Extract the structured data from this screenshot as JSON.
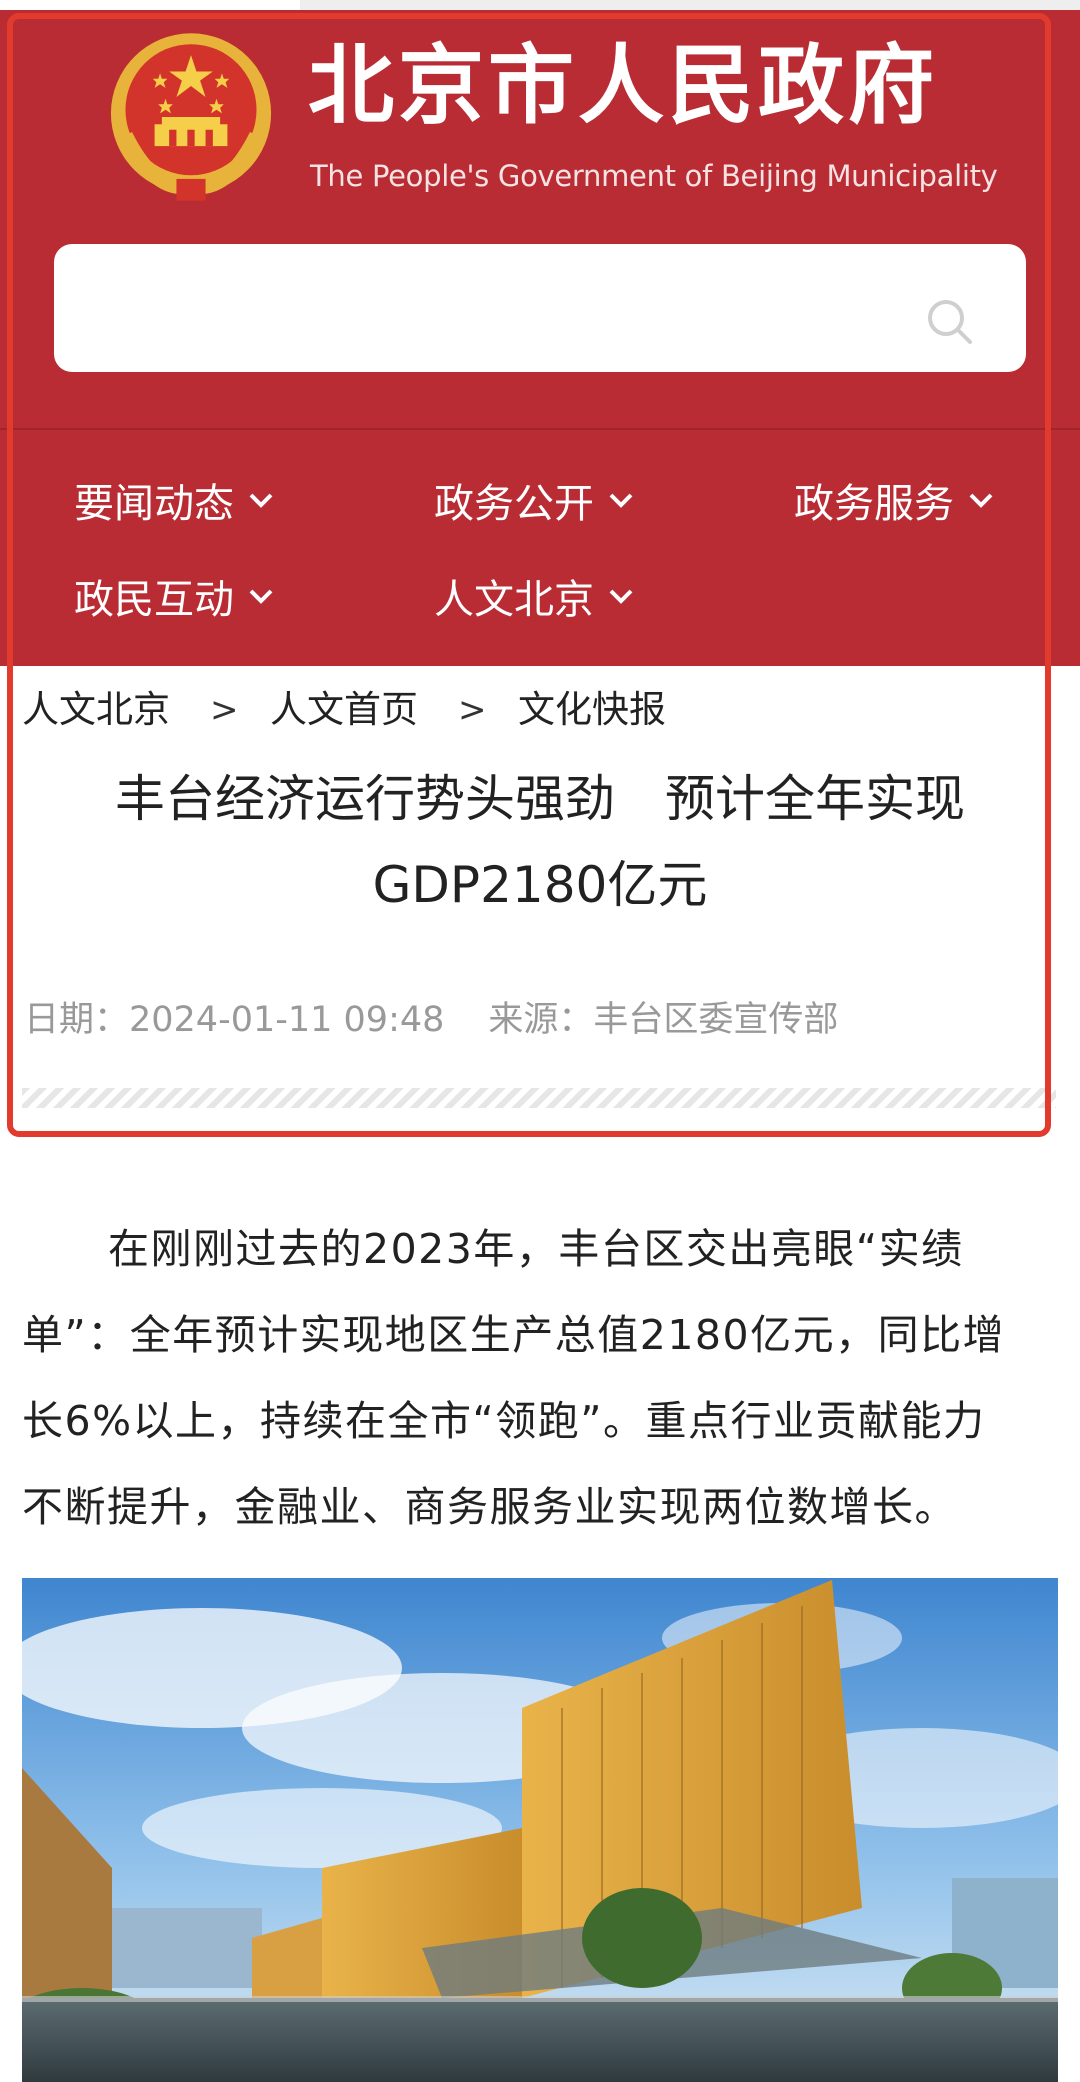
{
  "header": {
    "title": "北京市人民政府",
    "subtitle": "The People's Government of Beijing Municipality"
  },
  "search": {
    "value": "",
    "placeholder": ""
  },
  "nav": {
    "items": [
      {
        "label": "要闻动态"
      },
      {
        "label": "政务公开"
      },
      {
        "label": "政务服务"
      },
      {
        "label": "政民互动"
      },
      {
        "label": "人文北京"
      }
    ]
  },
  "breadcrumb": {
    "items": [
      "人文北京",
      "人文首页",
      "文化快报"
    ],
    "separator": ">"
  },
  "article": {
    "title_lines": [
      "丰台经济运行势头强劲　预计全年实现",
      "GDP2180亿元"
    ],
    "date": "日期：2024-01-11 09:48",
    "source": "来源：丰台区委宣传部",
    "body_lines": [
      "在刚刚过去的2023年，丰台区交出亮眼“实绩",
      "单”：全年预计实现地区生产总值2180亿元，同比增",
      "长6%以上，持续在全市“领跑”。重点行业贡献能力",
      "不断提升，金融业、商务服务业实现两位数增长。"
    ]
  },
  "colors": {
    "header_red": "#b92c34",
    "highlight_border": "#e23a2c",
    "meta_gray": "#999999"
  },
  "icons": [
    "national-emblem",
    "search-icon",
    "chevron-down-icon"
  ]
}
